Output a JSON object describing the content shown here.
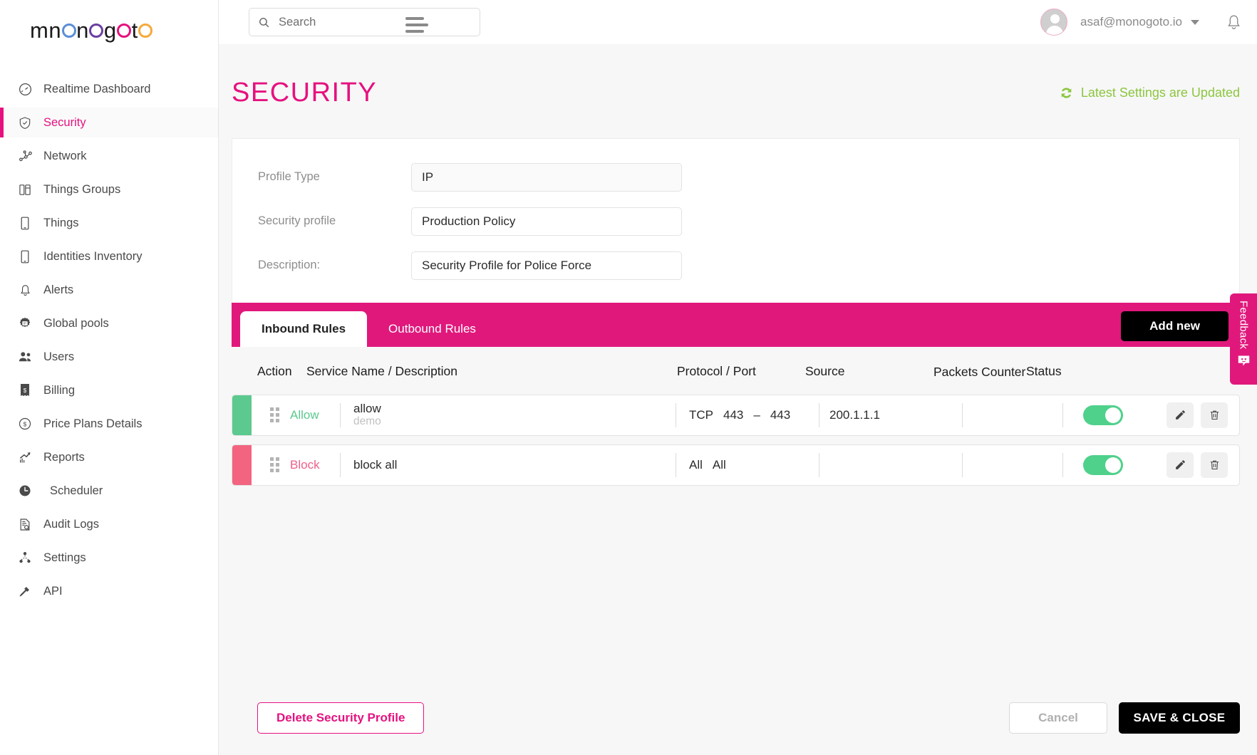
{
  "brand": {
    "name": "monogoto",
    "colors": {
      "pink": "#e6117f",
      "tab_pink": "#e0187c",
      "green": "#8cc63f",
      "allow_green": "#5cc98e",
      "block_pink": "#f2647f",
      "black": "#000000"
    }
  },
  "topbar": {
    "search_placeholder": "Search",
    "search_value": "",
    "user_email": "asaf@monogoto.io"
  },
  "sidebar": {
    "items": [
      {
        "label": "Realtime Dashboard",
        "icon": "gauge-icon",
        "active": false
      },
      {
        "label": "Security",
        "icon": "shield-check-icon",
        "active": true
      },
      {
        "label": "Network",
        "icon": "network-nodes-icon",
        "active": false
      },
      {
        "label": "Things Groups",
        "icon": "things-groups-icon",
        "active": false
      },
      {
        "label": "Things",
        "icon": "device-icon",
        "active": false
      },
      {
        "label": "Identities Inventory",
        "icon": "sim-card-icon",
        "active": false
      },
      {
        "label": "Alerts",
        "icon": "bell-icon",
        "active": false
      },
      {
        "label": "Global pools",
        "icon": "ip-gear-icon",
        "active": false
      },
      {
        "label": "Users",
        "icon": "users-icon",
        "active": false
      },
      {
        "label": "Billing",
        "icon": "receipt-dollar-icon",
        "active": false
      },
      {
        "label": "Price Plans Details",
        "icon": "dollar-circle-icon",
        "active": false
      },
      {
        "label": "Reports",
        "icon": "chart-up-icon",
        "active": false
      },
      {
        "label": "Scheduler",
        "icon": "clock-icon",
        "active": false
      },
      {
        "label": "Audit Logs",
        "icon": "document-search-icon",
        "active": false
      },
      {
        "label": "Settings",
        "icon": "sitemap-icon",
        "active": false
      },
      {
        "label": "API",
        "icon": "plug-icon",
        "active": false
      }
    ]
  },
  "page": {
    "title": "SECURITY",
    "status_text": "Latest Settings are Updated",
    "status_icon": "refresh-sync-icon"
  },
  "form": {
    "profile_type": {
      "label": "Profile Type",
      "value": "IP"
    },
    "security_profile": {
      "label": "Security profile",
      "value": "Production Policy"
    },
    "description": {
      "label": "Description:",
      "value": "Security Profile for Police Force"
    }
  },
  "tabs": {
    "items": [
      {
        "label": "Inbound Rules",
        "active": true
      },
      {
        "label": "Outbound Rules",
        "active": false
      }
    ],
    "add_new_label": "Add new"
  },
  "table": {
    "headers": {
      "action": "Action",
      "service": "Service Name / Description",
      "protocol": "Protocol / Port",
      "source": "Source",
      "packets": "Packets Counter",
      "status": "Status"
    },
    "rows": [
      {
        "action": "Allow",
        "action_kind": "allow",
        "service_name": "allow",
        "service_desc": "demo",
        "protocol": "TCP",
        "port_from": "443",
        "port_dash": "–",
        "port_to": "443",
        "source": "200.1.1.1",
        "packets": "",
        "enabled": true
      },
      {
        "action": "Block",
        "action_kind": "block",
        "service_name": "block all",
        "service_desc": "",
        "protocol": "All",
        "port_from": "All",
        "port_dash": "",
        "port_to": "",
        "source": "",
        "packets": "",
        "enabled": true
      }
    ],
    "row_actions": {
      "edit": "edit-pencil-icon",
      "delete": "trash-icon"
    }
  },
  "footer": {
    "delete_label": "Delete Security Profile",
    "cancel_label": "Cancel",
    "save_label": "SAVE & CLOSE"
  },
  "feedback": {
    "label": "Feedback"
  }
}
